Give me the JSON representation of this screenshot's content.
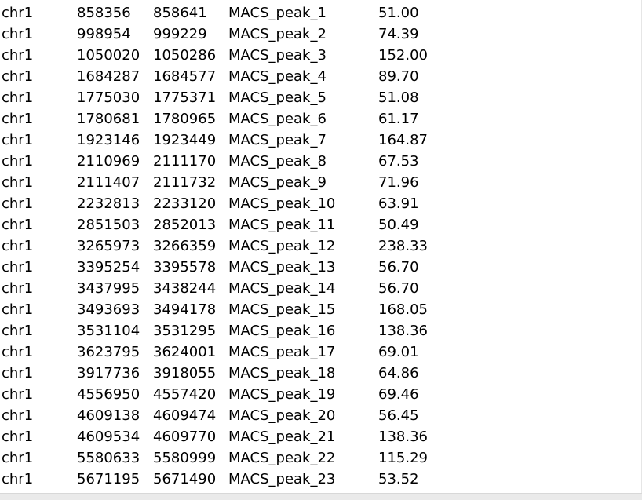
{
  "editor": {
    "rows": [
      [
        "chr1",
        "858356",
        "858641",
        "MACS_peak_1",
        "51.00"
      ],
      [
        "chr1",
        "998954",
        "999229",
        "MACS_peak_2",
        "74.39"
      ],
      [
        "chr1",
        "1050020",
        "1050286",
        "MACS_peak_3",
        "152.00"
      ],
      [
        "chr1",
        "1684287",
        "1684577",
        "MACS_peak_4",
        "89.70"
      ],
      [
        "chr1",
        "1775030",
        "1775371",
        "MACS_peak_5",
        "51.08"
      ],
      [
        "chr1",
        "1780681",
        "1780965",
        "MACS_peak_6",
        "61.17"
      ],
      [
        "chr1",
        "1923146",
        "1923449",
        "MACS_peak_7",
        "164.87"
      ],
      [
        "chr1",
        "2110969",
        "2111170",
        "MACS_peak_8",
        "67.53"
      ],
      [
        "chr1",
        "2111407",
        "2111732",
        "MACS_peak_9",
        "71.96"
      ],
      [
        "chr1",
        "2232813",
        "2233120",
        "MACS_peak_10",
        "63.91"
      ],
      [
        "chr1",
        "2851503",
        "2852013",
        "MACS_peak_11",
        "50.49"
      ],
      [
        "chr1",
        "3265973",
        "3266359",
        "MACS_peak_12",
        "238.33"
      ],
      [
        "chr1",
        "3395254",
        "3395578",
        "MACS_peak_13",
        "56.70"
      ],
      [
        "chr1",
        "3437995",
        "3438244",
        "MACS_peak_14",
        "56.70"
      ],
      [
        "chr1",
        "3493693",
        "3494178",
        "MACS_peak_15",
        "168.05"
      ],
      [
        "chr1",
        "3531104",
        "3531295",
        "MACS_peak_16",
        "138.36"
      ],
      [
        "chr1",
        "3623795",
        "3624001",
        "MACS_peak_17",
        "69.01"
      ],
      [
        "chr1",
        "3917736",
        "3918055",
        "MACS_peak_18",
        "64.86"
      ],
      [
        "chr1",
        "4556950",
        "4557420",
        "MACS_peak_19",
        "69.46"
      ],
      [
        "chr1",
        "4609138",
        "4609474",
        "MACS_peak_20",
        "56.45"
      ],
      [
        "chr1",
        "4609534",
        "4609770",
        "MACS_peak_21",
        "138.36"
      ],
      [
        "chr1",
        "5580633",
        "5580999",
        "MACS_peak_22",
        "115.29"
      ],
      [
        "chr1",
        "5671195",
        "5671490",
        "MACS_peak_23",
        "53.52"
      ]
    ]
  }
}
